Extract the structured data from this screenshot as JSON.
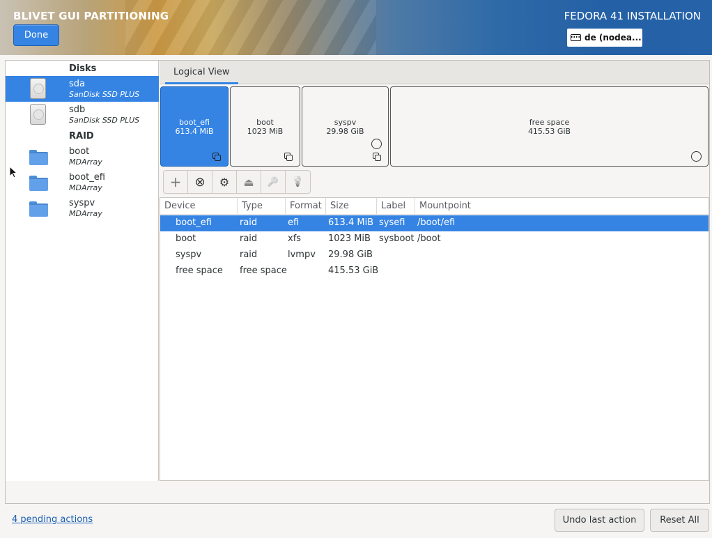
{
  "header": {
    "left_title": "BLIVET GUI PARTITIONING",
    "done_label": "Done",
    "right_title": "FEDORA 41 INSTALLATION",
    "keyboard_layout": "de (nodea..."
  },
  "sidebar": {
    "disks_title": "Disks",
    "raid_title": "RAID",
    "disks": [
      {
        "name": "sda",
        "model": "SanDisk SSD PLUS"
      },
      {
        "name": "sdb",
        "model": "SanDisk SSD PLUS"
      }
    ],
    "raid": [
      {
        "name": "boot",
        "type": "MDArray"
      },
      {
        "name": "boot_efi",
        "type": "MDArray"
      },
      {
        "name": "syspv",
        "type": "MDArray"
      }
    ]
  },
  "view": {
    "tab_label": "Logical View"
  },
  "blocks": [
    {
      "name": "boot_efi",
      "size": "613.4 MiB"
    },
    {
      "name": "boot",
      "size": "1023 MiB"
    },
    {
      "name": "syspv",
      "size": "29.98 GiB"
    },
    {
      "name": "free space",
      "size": "415.53 GiB"
    }
  ],
  "toolbar": {
    "add": "+",
    "delete": "⊗",
    "edit": "⚙",
    "unmount": "⏏",
    "decrypt": "🔑",
    "info": "💡"
  },
  "table": {
    "headers": [
      "Device",
      "Type",
      "Format",
      "Size",
      "Label",
      "Mountpoint"
    ],
    "rows": [
      {
        "device": "boot_efi",
        "type": "raid",
        "format": "efi",
        "size": "613.4 MiB",
        "label": "sysefi",
        "mountpoint": "/boot/efi"
      },
      {
        "device": "boot",
        "type": "raid",
        "format": "xfs",
        "size": "1023 MiB",
        "label": "sysboot",
        "mountpoint": "/boot"
      },
      {
        "device": "syspv",
        "type": "raid",
        "format": "lvmpv",
        "size": "29.98 GiB",
        "label": "",
        "mountpoint": ""
      },
      {
        "device": "free space",
        "type": "free space",
        "format": "",
        "size": "415.53 GiB",
        "label": "",
        "mountpoint": ""
      }
    ]
  },
  "footer": {
    "pending_actions": "4 pending actions",
    "undo_label": "Undo last action",
    "reset_label": "Reset All"
  }
}
